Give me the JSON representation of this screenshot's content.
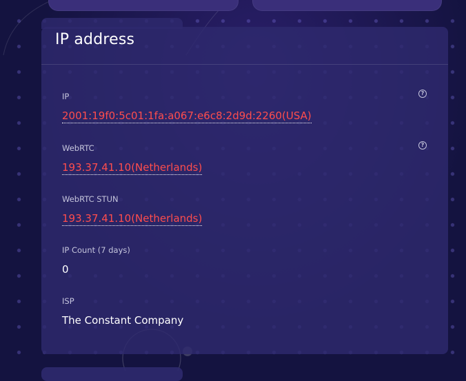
{
  "panel": {
    "title": "IP address",
    "fields": [
      {
        "label": "IP",
        "value": "2001:19f0:5c01:1fa:a067:e6c8:2d9d:2260(USA)",
        "help_icon": "question-circle-icon"
      },
      {
        "label": "WebRTC",
        "value": "193.37.41.10(Netherlands)",
        "help_icon": "question-circle-icon"
      },
      {
        "label": "WebRTC STUN",
        "value": "193.37.41.10(Netherlands)"
      },
      {
        "label": "IP Count (7 days)",
        "value": "0"
      },
      {
        "label": "ISP",
        "value": "The Constant Company"
      }
    ]
  },
  "colors": {
    "background": "#141340",
    "panel": "#2e2a6e",
    "alert_value": "#ff4d4d",
    "label": "#c5c5dc"
  }
}
